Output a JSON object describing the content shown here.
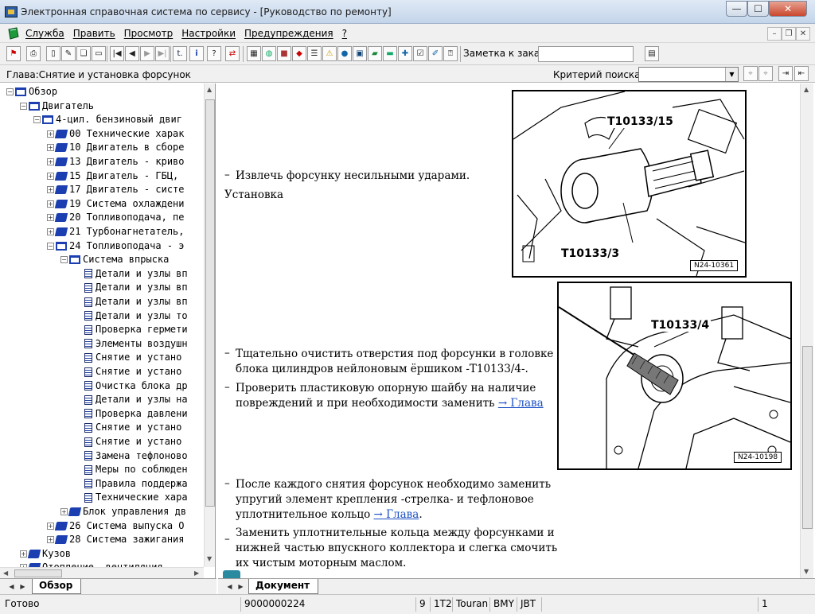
{
  "window": {
    "title": "Электронная справочная система по сервису - [Руководство по ремонту]",
    "btn_min": "—",
    "btn_max": "☐",
    "btn_close": "✕"
  },
  "menu": {
    "items": [
      "Служба",
      "Править",
      "Просмотр",
      "Настройки",
      "Предупреждения",
      "?"
    ]
  },
  "toolbar": {
    "note_label": "Заметка к заказу:"
  },
  "chapter": {
    "title": "Глава:Снятие и установка форсунок",
    "search_label": "Критерий  поиска:",
    "search_value": ""
  },
  "tree": {
    "nodes": [
      {
        "level": 0,
        "text": "Обзор",
        "icon": "book-open-icon",
        "expander": "−"
      },
      {
        "level": 1,
        "text": "Двигатель",
        "icon": "book-open-icon",
        "expander": "−"
      },
      {
        "level": 2,
        "text": "4-цил. бензиновый двиг",
        "icon": "book-open-icon",
        "expander": "−"
      },
      {
        "level": 3,
        "text": "00 Технические харак",
        "icon": "book-icon",
        "expander": "+"
      },
      {
        "level": 3,
        "text": "10 Двигатель в сборе",
        "icon": "book-icon",
        "expander": "+"
      },
      {
        "level": 3,
        "text": "13 Двигатель - криво",
        "icon": "book-icon",
        "expander": "+"
      },
      {
        "level": 3,
        "text": "15 Двигатель - ГБЦ, ",
        "icon": "book-icon",
        "expander": "+"
      },
      {
        "level": 3,
        "text": "17 Двигатель - систе",
        "icon": "book-icon",
        "expander": "+"
      },
      {
        "level": 3,
        "text": "19 Система охлаждени",
        "icon": "book-icon",
        "expander": "+"
      },
      {
        "level": 3,
        "text": "20 Топливоподача, пе",
        "icon": "book-icon",
        "expander": "+"
      },
      {
        "level": 3,
        "text": "21 Турбонагнетатель,",
        "icon": "book-icon",
        "expander": "+"
      },
      {
        "level": 3,
        "text": "24 Топливоподача - э",
        "icon": "book-open-icon",
        "expander": "−"
      },
      {
        "level": 4,
        "text": "Система впрыска",
        "icon": "book-open-icon",
        "expander": "−"
      },
      {
        "level": 5,
        "text": "Детали и узлы вп",
        "icon": "document-icon",
        "expander": ""
      },
      {
        "level": 5,
        "text": "Детали и узлы вп",
        "icon": "document-icon",
        "expander": ""
      },
      {
        "level": 5,
        "text": "Детали и узлы вп",
        "icon": "document-icon",
        "expander": ""
      },
      {
        "level": 5,
        "text": "Детали и узлы то",
        "icon": "document-icon",
        "expander": ""
      },
      {
        "level": 5,
        "text": "Проверка гермети",
        "icon": "document-icon",
        "expander": ""
      },
      {
        "level": 5,
        "text": "Элементы воздушн",
        "icon": "document-icon",
        "expander": ""
      },
      {
        "level": 5,
        "text": "Снятие и устано",
        "icon": "document-icon",
        "expander": ""
      },
      {
        "level": 5,
        "text": "Снятие и устано",
        "icon": "document-icon",
        "expander": ""
      },
      {
        "level": 5,
        "text": "Очистка блока др",
        "icon": "document-icon",
        "expander": ""
      },
      {
        "level": 5,
        "text": "Детали и узлы на",
        "icon": "document-icon",
        "expander": ""
      },
      {
        "level": 5,
        "text": "Проверка давлени",
        "icon": "document-icon",
        "expander": ""
      },
      {
        "level": 5,
        "text": "Снятие и устано",
        "icon": "document-icon",
        "expander": ""
      },
      {
        "level": 5,
        "text": "Снятие и устано",
        "icon": "document-icon",
        "expander": ""
      },
      {
        "level": 5,
        "text": "Замена тефлоново",
        "icon": "document-icon",
        "expander": ""
      },
      {
        "level": 5,
        "text": "Меры по соблюден",
        "icon": "document-icon",
        "expander": ""
      },
      {
        "level": 5,
        "text": "Правила поддержа",
        "icon": "document-icon",
        "expander": ""
      },
      {
        "level": 5,
        "text": "Технические хара",
        "icon": "document-icon",
        "expander": ""
      },
      {
        "level": 4,
        "text": "Блок управления дв",
        "icon": "book-icon",
        "expander": "+"
      },
      {
        "level": 3,
        "text": "26 Система выпуска О",
        "icon": "book-icon",
        "expander": "+"
      },
      {
        "level": 3,
        "text": "28 Система зажигания",
        "icon": "book-icon",
        "expander": "+"
      },
      {
        "level": 1,
        "text": "Кузов",
        "icon": "book-icon",
        "expander": "+"
      },
      {
        "level": 1,
        "text": "Отопление, вентиляция",
        "icon": "book-icon",
        "expander": "+"
      }
    ]
  },
  "document": {
    "p1": "Извлечь форсунку несильными ударами.",
    "heading_install": "Установка",
    "p2a": "Тщательно очистить отверстия под форсунки в головке",
    "p2b": "блока цилиндров нейлоновым ёршиком -T10133/4-.",
    "p3a": "Проверить пластиковую опорную шайбу на наличие",
    "p3b": "повреждений и при необходимости заменить ",
    "p3_link": "→ Глава",
    "p4a": "После каждого снятия форсунок необходимо заменить",
    "p4b": "упругий элемент крепления -стрелка- и тефлоновое",
    "p4c": "уплотнительное кольцо ",
    "p4_link": "→ Глава",
    "p4_end": ".",
    "p5a": "Заменить уплотнительные кольца между форсунками и",
    "p5b": "нижней частью впускного коллектора и слегка смочить",
    "p5c": "их чистым моторным маслом.",
    "dash": "–",
    "fig1": {
      "label_a": "T10133/15",
      "label_b": "T10133/3",
      "id": "N24-10361"
    },
    "fig2": {
      "label_a": "T10133/4",
      "id": "N24-10198"
    }
  },
  "tabs": {
    "left": "Обзор",
    "right": "Документ"
  },
  "status": {
    "ready": "Готово",
    "order": "9000000224",
    "c1": "9",
    "c2": "1T2",
    "c3": "Touran",
    "c4": "BMY",
    "c5": "JBT",
    "c6": "1"
  }
}
